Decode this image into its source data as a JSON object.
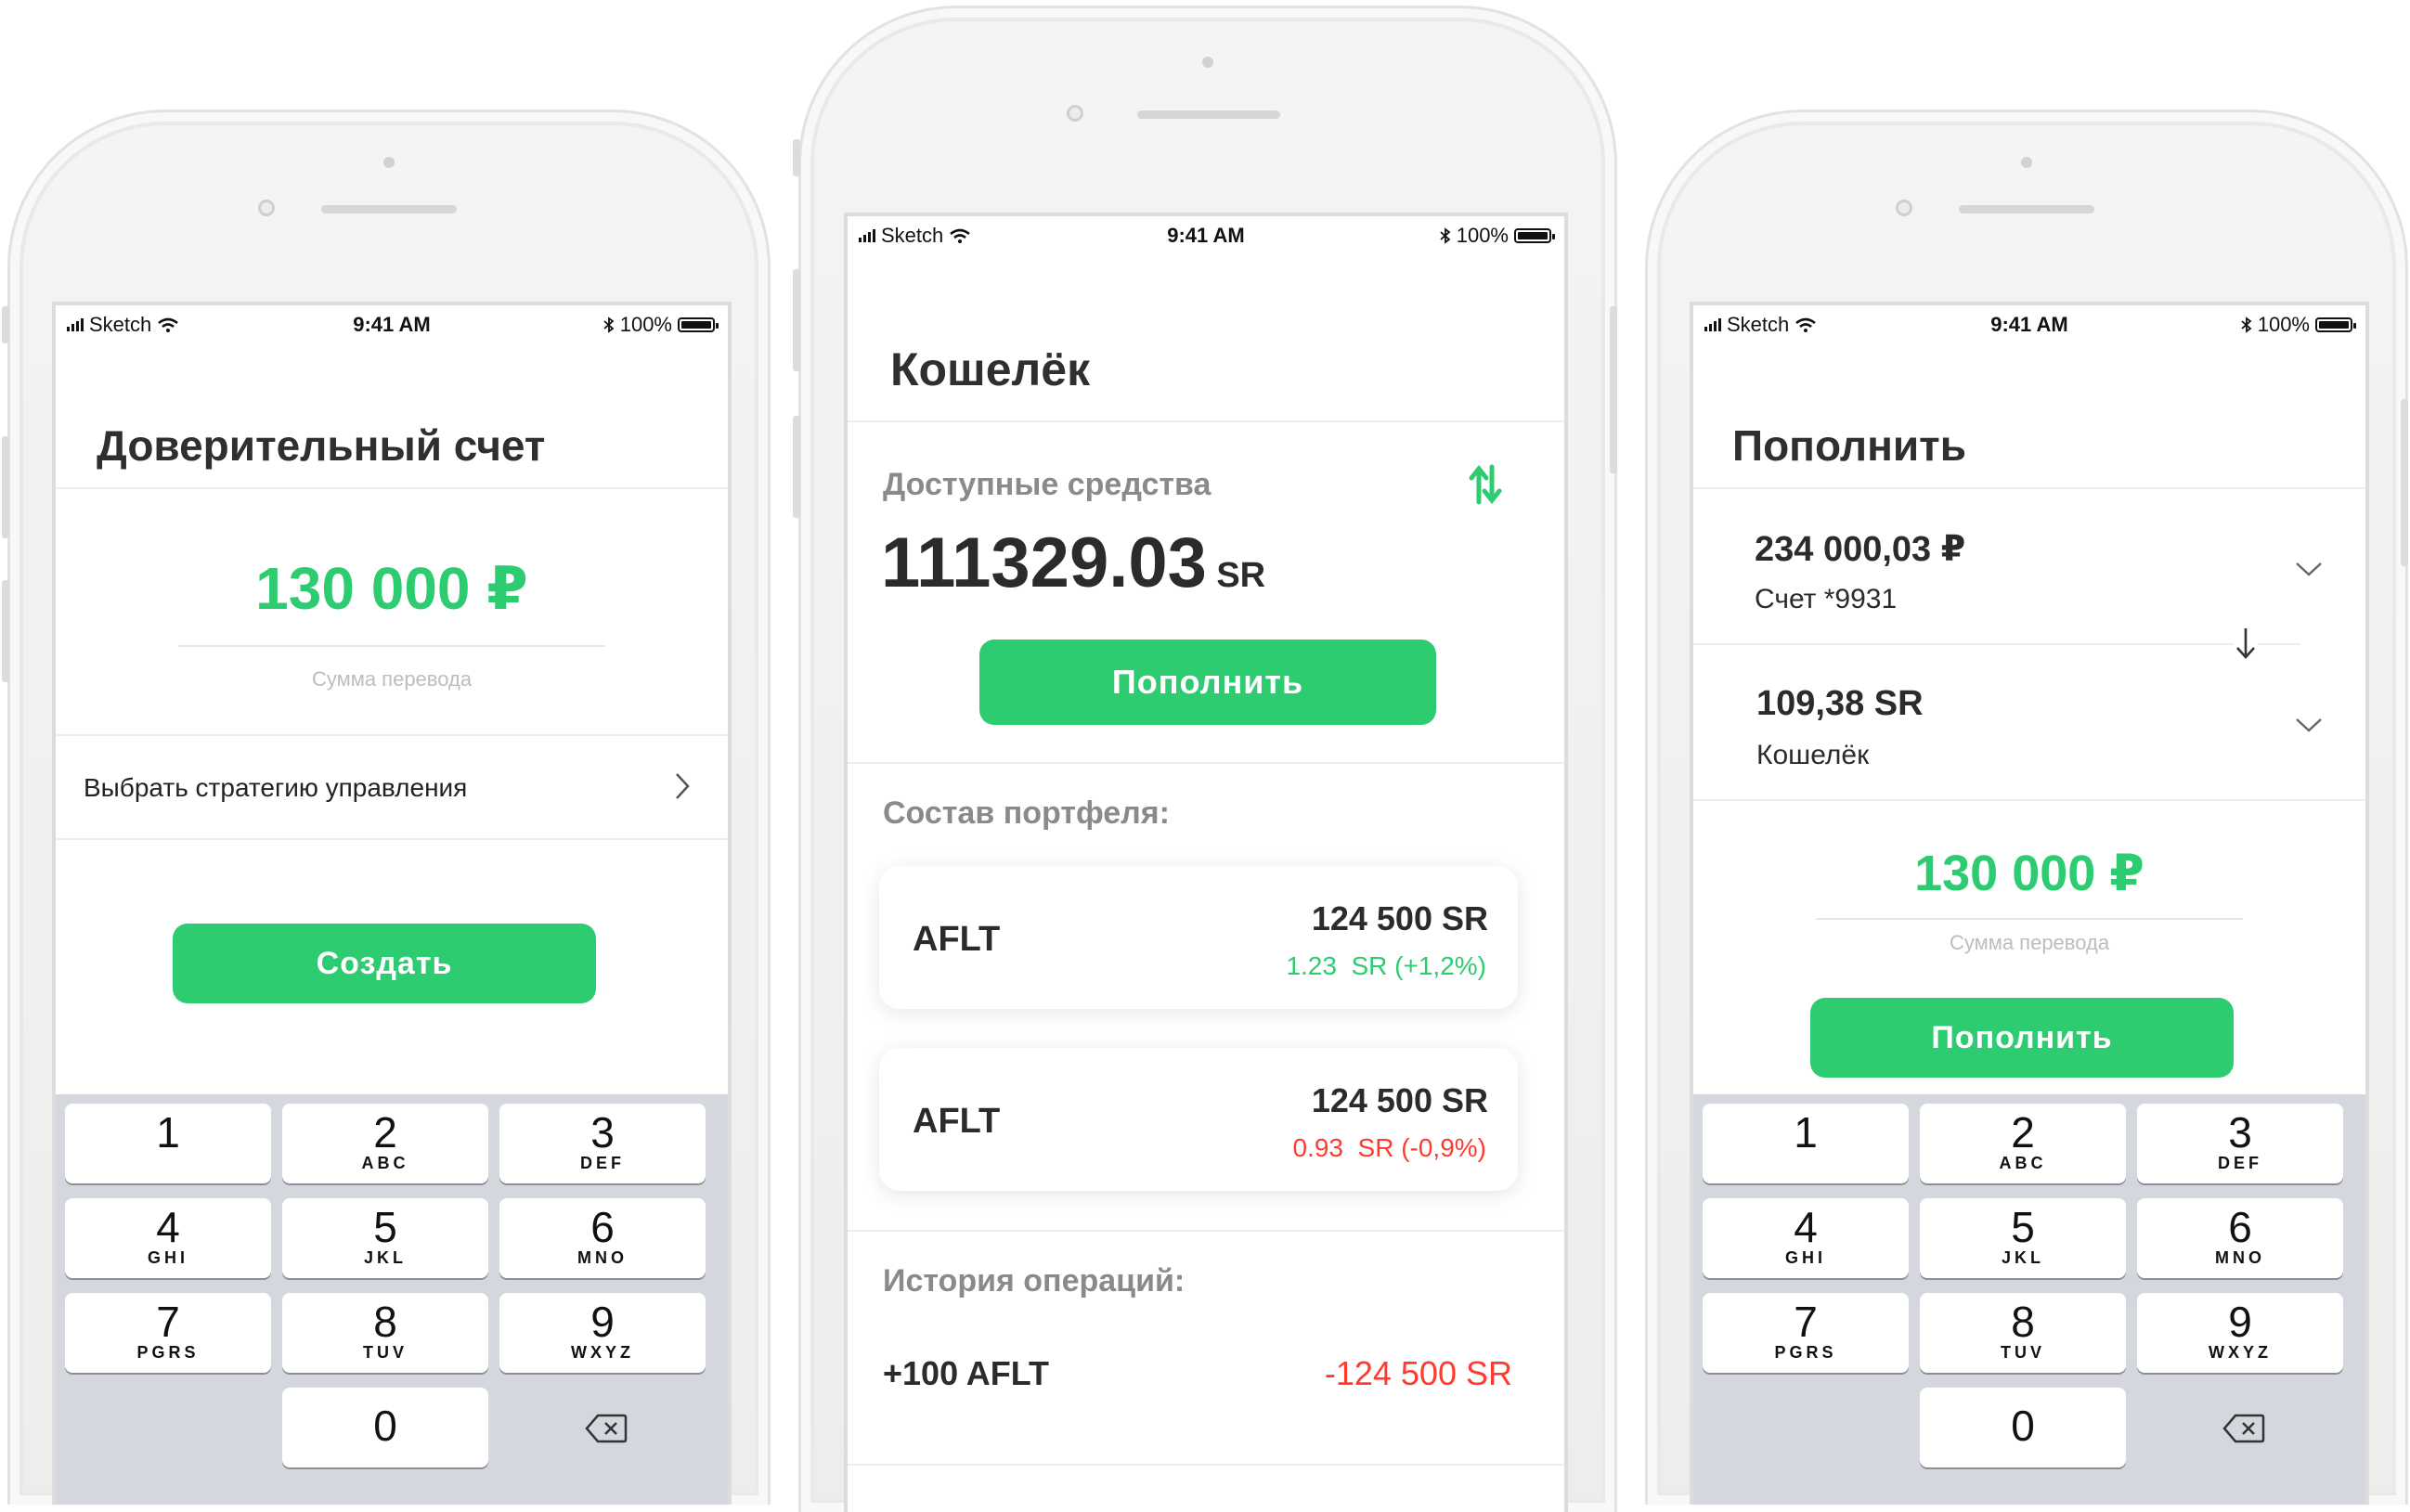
{
  "status_bar": {
    "carrier": "Sketch",
    "time": "9:41 AM",
    "battery": "100%"
  },
  "colors": {
    "accent_green": "#2ecc71",
    "negative_red": "#ff3b30"
  },
  "keypad": [
    {
      "num": "1",
      "letters": ""
    },
    {
      "num": "2",
      "letters": "ABC"
    },
    {
      "num": "3",
      "letters": "DEF"
    },
    {
      "num": "4",
      "letters": "GHI"
    },
    {
      "num": "5",
      "letters": "JKL"
    },
    {
      "num": "6",
      "letters": "MNO"
    },
    {
      "num": "7",
      "letters": "PGRS"
    },
    {
      "num": "8",
      "letters": "TUV"
    },
    {
      "num": "9",
      "letters": "WXYZ"
    },
    {
      "num": "0",
      "letters": ""
    }
  ],
  "left_screen": {
    "title": "Доверительный счет",
    "amount": "130 000 ₽",
    "amount_caption": "Сумма перевода",
    "strategy_label": "Выбрать стратегию управления",
    "create_button": "Создать"
  },
  "center_screen": {
    "title": "Кошелёк",
    "available_label": "Доступные средства",
    "balance_value": "111329.03",
    "balance_unit": "SR",
    "topup_button": "Пополнить",
    "portfolio_label": "Состав портфеля:",
    "portfolio": [
      {
        "ticker": "AFLT",
        "value": "124 500 SR",
        "change": "1.23  SR (+1,2%)",
        "trend": "up"
      },
      {
        "ticker": "AFLT",
        "value": "124 500 SR",
        "change": "0.93  SR (-0,9%)",
        "trend": "down"
      }
    ],
    "history_label": "История операций:",
    "history": [
      {
        "operation": "+100 AFLT",
        "amount": "-124 500 SR"
      }
    ]
  },
  "right_screen": {
    "title": "Пополнить",
    "from": {
      "amount": "234 000,03 ₽",
      "account": "Счет *9931"
    },
    "to": {
      "amount": "109,38 SR",
      "account": "Кошелёк"
    },
    "amount": "130 000 ₽",
    "amount_caption": "Сумма перевода",
    "topup_button": "Пополнить"
  }
}
